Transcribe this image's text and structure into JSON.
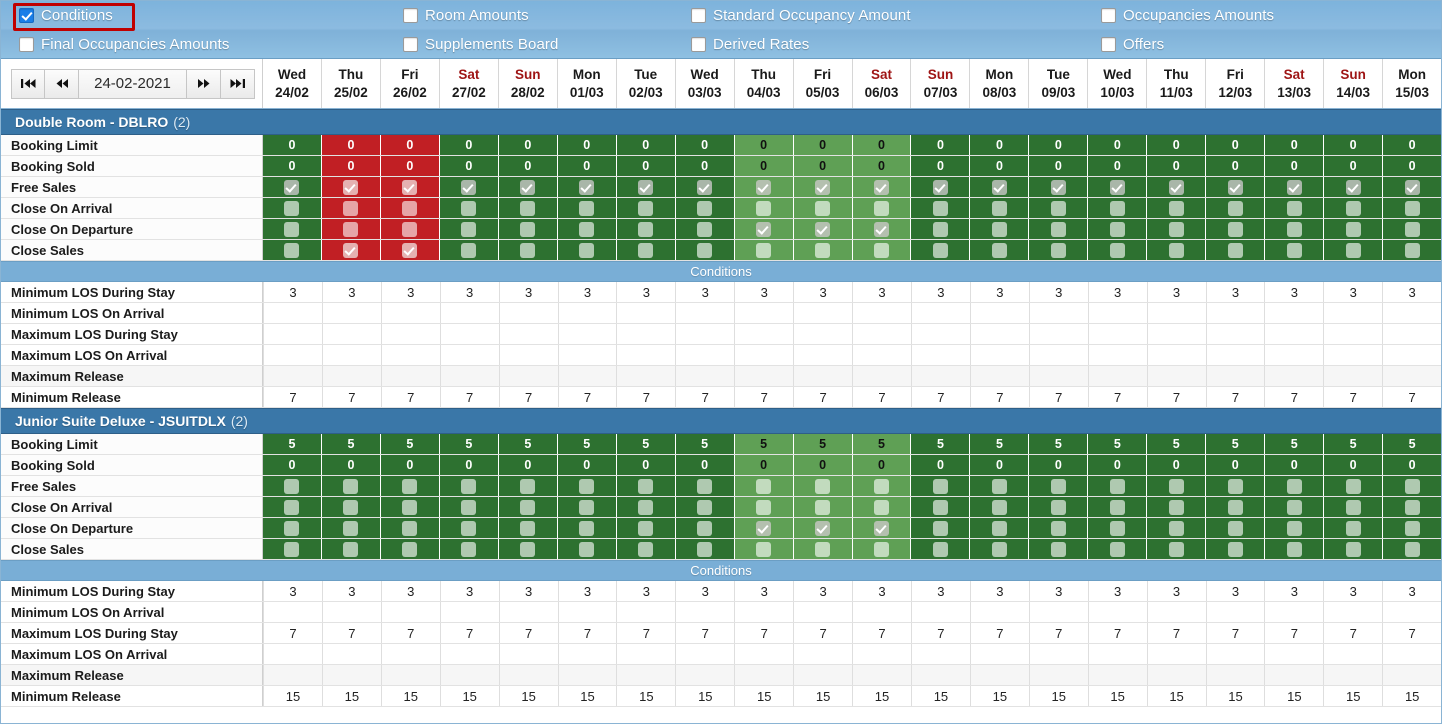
{
  "filters": {
    "rows": [
      [
        {
          "label": "Conditions",
          "checked": true,
          "highlight": true
        },
        {
          "label": "Room Amounts",
          "checked": false,
          "highlight": false
        },
        {
          "label": "Standard Occupancy Amount",
          "checked": false,
          "highlight": false
        },
        {
          "label": "Occupancies Amounts",
          "checked": false,
          "highlight": false
        }
      ],
      [
        {
          "label": "Final Occupancies Amounts",
          "checked": false,
          "highlight": false
        },
        {
          "label": "Supplements Board",
          "checked": false,
          "highlight": false
        },
        {
          "label": "Derived Rates",
          "checked": false,
          "highlight": false
        },
        {
          "label": "Offers",
          "checked": false,
          "highlight": false
        }
      ]
    ]
  },
  "nav": {
    "first_label": "⏮",
    "prev_label": "⏪",
    "date_value": "24-02-2021",
    "next_label": "⏩",
    "last_label": "⏭"
  },
  "dates": [
    {
      "dow": "Wed",
      "date": "24/02",
      "weekend": false
    },
    {
      "dow": "Thu",
      "date": "25/02",
      "weekend": false
    },
    {
      "dow": "Fri",
      "date": "26/02",
      "weekend": false
    },
    {
      "dow": "Sat",
      "date": "27/02",
      "weekend": true
    },
    {
      "dow": "Sun",
      "date": "28/02",
      "weekend": true
    },
    {
      "dow": "Mon",
      "date": "01/03",
      "weekend": false
    },
    {
      "dow": "Tue",
      "date": "02/03",
      "weekend": false
    },
    {
      "dow": "Wed",
      "date": "03/03",
      "weekend": false
    },
    {
      "dow": "Thu",
      "date": "04/03",
      "weekend": false
    },
    {
      "dow": "Fri",
      "date": "05/03",
      "weekend": false
    },
    {
      "dow": "Sat",
      "date": "06/03",
      "weekend": true
    },
    {
      "dow": "Sun",
      "date": "07/03",
      "weekend": true
    },
    {
      "dow": "Mon",
      "date": "08/03",
      "weekend": false
    },
    {
      "dow": "Tue",
      "date": "09/03",
      "weekend": false
    },
    {
      "dow": "Wed",
      "date": "10/03",
      "weekend": false
    },
    {
      "dow": "Thu",
      "date": "11/03",
      "weekend": false
    },
    {
      "dow": "Fri",
      "date": "12/03",
      "weekend": false
    },
    {
      "dow": "Sat",
      "date": "13/03",
      "weekend": true
    },
    {
      "dow": "Sun",
      "date": "14/03",
      "weekend": true
    },
    {
      "dow": "Mon",
      "date": "15/03",
      "weekend": false
    }
  ],
  "colors": {
    "available": "#2d7130",
    "available_light": "#5fa055",
    "blocked": "#c11f24",
    "header_blue": "#3a77a8",
    "band_blue": "#79aed6",
    "filterbar_blue": "#8cbbe0",
    "weekend_text": "#9e1414",
    "highlight_border": "#c00000"
  },
  "conditions_band_label": "Conditions",
  "blocks": [
    {
      "title": "Double Room - DBLRO",
      "count": "(2)",
      "col_state": [
        "green",
        "red",
        "red",
        "green",
        "green",
        "green",
        "green",
        "green",
        "lgreen",
        "lgreen",
        "lgreen",
        "green",
        "green",
        "green",
        "green",
        "green",
        "green",
        "green",
        "green",
        "green"
      ],
      "value_rows": [
        {
          "label": "Booking Limit",
          "values": [
            "0",
            "0",
            "0",
            "0",
            "0",
            "0",
            "0",
            "0",
            "0",
            "0",
            "0",
            "0",
            "0",
            "0",
            "0",
            "0",
            "0",
            "0",
            "0",
            "0"
          ]
        },
        {
          "label": "Booking Sold",
          "values": [
            "0",
            "0",
            "0",
            "0",
            "0",
            "0",
            "0",
            "0",
            "0",
            "0",
            "0",
            "0",
            "0",
            "0",
            "0",
            "0",
            "0",
            "0",
            "0",
            "0"
          ]
        }
      ],
      "check_rows": [
        {
          "label": "Free Sales",
          "checks": [
            1,
            1,
            1,
            1,
            1,
            1,
            1,
            1,
            1,
            1,
            1,
            1,
            1,
            1,
            1,
            1,
            1,
            1,
            1,
            1
          ]
        },
        {
          "label": "Close On Arrival",
          "checks": [
            0,
            0,
            0,
            0,
            0,
            0,
            0,
            0,
            0,
            0,
            0,
            0,
            0,
            0,
            0,
            0,
            0,
            0,
            0,
            0
          ]
        },
        {
          "label": "Close On Departure",
          "checks": [
            0,
            0,
            0,
            0,
            0,
            0,
            0,
            0,
            1,
            1,
            1,
            0,
            0,
            0,
            0,
            0,
            0,
            0,
            0,
            0
          ]
        },
        {
          "label": "Close Sales",
          "checks": [
            0,
            1,
            1,
            0,
            0,
            0,
            0,
            0,
            0,
            0,
            0,
            0,
            0,
            0,
            0,
            0,
            0,
            0,
            0,
            0
          ]
        }
      ],
      "condition_rows": [
        {
          "label": "Minimum LOS During Stay",
          "shade": false,
          "values": [
            "3",
            "3",
            "3",
            "3",
            "3",
            "3",
            "3",
            "3",
            "3",
            "3",
            "3",
            "3",
            "3",
            "3",
            "3",
            "3",
            "3",
            "3",
            "3",
            "3"
          ]
        },
        {
          "label": "Minimum LOS On Arrival",
          "shade": false,
          "values": [
            "",
            "",
            "",
            "",
            "",
            "",
            "",
            "",
            "",
            "",
            "",
            "",
            "",
            "",
            "",
            "",
            "",
            "",
            "",
            ""
          ]
        },
        {
          "label": "Maximum LOS During Stay",
          "shade": false,
          "values": [
            "",
            "",
            "",
            "",
            "",
            "",
            "",
            "",
            "",
            "",
            "",
            "",
            "",
            "",
            "",
            "",
            "",
            "",
            "",
            ""
          ]
        },
        {
          "label": "Maximum LOS On Arrival",
          "shade": false,
          "values": [
            "",
            "",
            "",
            "",
            "",
            "",
            "",
            "",
            "",
            "",
            "",
            "",
            "",
            "",
            "",
            "",
            "",
            "",
            "",
            ""
          ]
        },
        {
          "label": "Maximum Release",
          "shade": true,
          "values": [
            "",
            "",
            "",
            "",
            "",
            "",
            "",
            "",
            "",
            "",
            "",
            "",
            "",
            "",
            "",
            "",
            "",
            "",
            "",
            ""
          ]
        },
        {
          "label": "Minimum Release",
          "shade": false,
          "values": [
            "7",
            "7",
            "7",
            "7",
            "7",
            "7",
            "7",
            "7",
            "7",
            "7",
            "7",
            "7",
            "7",
            "7",
            "7",
            "7",
            "7",
            "7",
            "7",
            "7"
          ]
        }
      ]
    },
    {
      "title": "Junior Suite Deluxe - JSUITDLX",
      "count": "(2)",
      "col_state": [
        "green",
        "green",
        "green",
        "green",
        "green",
        "green",
        "green",
        "green",
        "lgreen",
        "lgreen",
        "lgreen",
        "green",
        "green",
        "green",
        "green",
        "green",
        "green",
        "green",
        "green",
        "green"
      ],
      "value_rows": [
        {
          "label": "Booking Limit",
          "values": [
            "5",
            "5",
            "5",
            "5",
            "5",
            "5",
            "5",
            "5",
            "5",
            "5",
            "5",
            "5",
            "5",
            "5",
            "5",
            "5",
            "5",
            "5",
            "5",
            "5"
          ]
        },
        {
          "label": "Booking Sold",
          "values": [
            "0",
            "0",
            "0",
            "0",
            "0",
            "0",
            "0",
            "0",
            "0",
            "0",
            "0",
            "0",
            "0",
            "0",
            "0",
            "0",
            "0",
            "0",
            "0",
            "0"
          ]
        }
      ],
      "check_rows": [
        {
          "label": "Free Sales",
          "checks": [
            0,
            0,
            0,
            0,
            0,
            0,
            0,
            0,
            0,
            0,
            0,
            0,
            0,
            0,
            0,
            0,
            0,
            0,
            0,
            0
          ]
        },
        {
          "label": "Close On Arrival",
          "checks": [
            0,
            0,
            0,
            0,
            0,
            0,
            0,
            0,
            0,
            0,
            0,
            0,
            0,
            0,
            0,
            0,
            0,
            0,
            0,
            0
          ]
        },
        {
          "label": "Close On Departure",
          "checks": [
            0,
            0,
            0,
            0,
            0,
            0,
            0,
            0,
            1,
            1,
            1,
            0,
            0,
            0,
            0,
            0,
            0,
            0,
            0,
            0
          ]
        },
        {
          "label": "Close Sales",
          "checks": [
            0,
            0,
            0,
            0,
            0,
            0,
            0,
            0,
            0,
            0,
            0,
            0,
            0,
            0,
            0,
            0,
            0,
            0,
            0,
            0
          ]
        }
      ],
      "condition_rows": [
        {
          "label": "Minimum LOS During Stay",
          "shade": false,
          "values": [
            "3",
            "3",
            "3",
            "3",
            "3",
            "3",
            "3",
            "3",
            "3",
            "3",
            "3",
            "3",
            "3",
            "3",
            "3",
            "3",
            "3",
            "3",
            "3",
            "3"
          ]
        },
        {
          "label": "Minimum LOS On Arrival",
          "shade": false,
          "values": [
            "",
            "",
            "",
            "",
            "",
            "",
            "",
            "",
            "",
            "",
            "",
            "",
            "",
            "",
            "",
            "",
            "",
            "",
            "",
            ""
          ]
        },
        {
          "label": "Maximum LOS During Stay",
          "shade": false,
          "values": [
            "7",
            "7",
            "7",
            "7",
            "7",
            "7",
            "7",
            "7",
            "7",
            "7",
            "7",
            "7",
            "7",
            "7",
            "7",
            "7",
            "7",
            "7",
            "7",
            "7"
          ]
        },
        {
          "label": "Maximum LOS On Arrival",
          "shade": false,
          "values": [
            "",
            "",
            "",
            "",
            "",
            "",
            "",
            "",
            "",
            "",
            "",
            "",
            "",
            "",
            "",
            "",
            "",
            "",
            "",
            ""
          ]
        },
        {
          "label": "Maximum Release",
          "shade": true,
          "values": [
            "",
            "",
            "",
            "",
            "",
            "",
            "",
            "",
            "",
            "",
            "",
            "",
            "",
            "",
            "",
            "",
            "",
            "",
            "",
            ""
          ]
        },
        {
          "label": "Minimum Release",
          "shade": false,
          "values": [
            "15",
            "15",
            "15",
            "15",
            "15",
            "15",
            "15",
            "15",
            "15",
            "15",
            "15",
            "15",
            "15",
            "15",
            "15",
            "15",
            "15",
            "15",
            "15",
            "15"
          ]
        }
      ]
    }
  ]
}
